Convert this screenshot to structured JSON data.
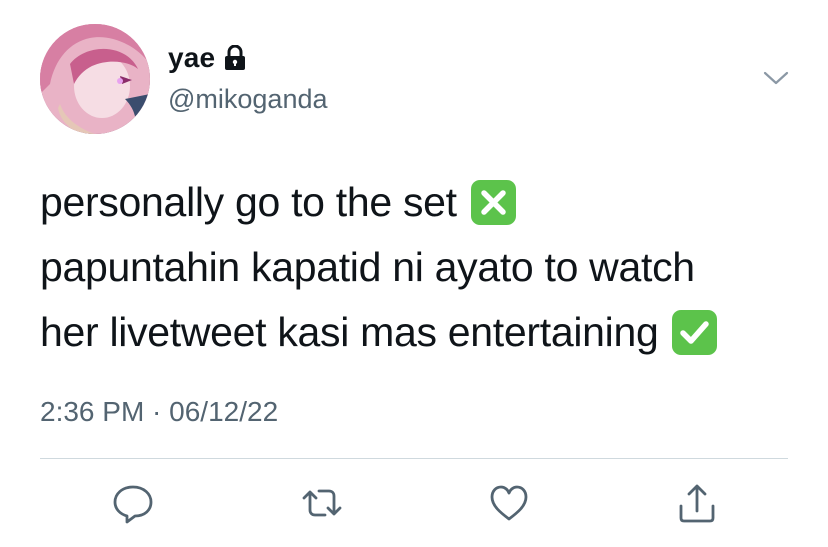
{
  "user": {
    "display_name": "yae",
    "handle": "@mikoganda",
    "protected": true
  },
  "tweet": {
    "lines": [
      "personally go to the set",
      "papuntahin kapatid ni ayato to watch",
      "her livetweet kasi mas entertaining"
    ],
    "emoji_line1": "cross-mark-emoji",
    "emoji_line3": "check-mark-emoji",
    "timestamp": "2:36 PM · 06/12/22"
  },
  "actions": [
    "reply-icon",
    "retweet-icon",
    "like-icon",
    "share-icon"
  ],
  "colors": {
    "text": "#0f1419",
    "secondary": "#536471",
    "divider": "#cfd9de",
    "emoji_green": "#5cc34b"
  }
}
